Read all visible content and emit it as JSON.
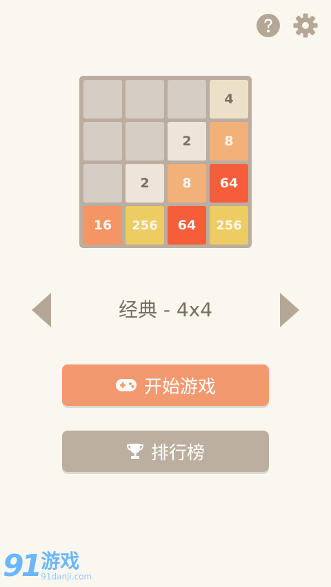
{
  "header": {
    "icons": [
      "help-icon",
      "gear-icon"
    ],
    "icon_color": "#b5a796"
  },
  "board": {
    "rows": [
      [
        "",
        "",
        "",
        "4"
      ],
      [
        "",
        "",
        "2",
        "8"
      ],
      [
        "",
        "2",
        "8",
        "64"
      ],
      [
        "16",
        "256",
        "64",
        "256"
      ]
    ],
    "colors": {
      "empty": "#d6cdc4",
      "2": "#eee4da",
      "4": "#ede0c8",
      "8": "#f2b179",
      "16": "#f59563",
      "64": "#f65e3b",
      "256": "#edcc61",
      "dark_text": "#776e65",
      "light_text": "#f9f6f2"
    }
  },
  "mode": {
    "label": "经典 - 4x4",
    "prev_icon": "chevron-left-icon",
    "next_icon": "chevron-right-icon"
  },
  "buttons": {
    "start_label": "开始游戏",
    "start_icon": "gamepad-icon",
    "rank_label": "排行榜",
    "rank_icon": "trophy-icon"
  },
  "watermark": {
    "logo": "91",
    "name": "游戏",
    "url": "91danji.com"
  }
}
